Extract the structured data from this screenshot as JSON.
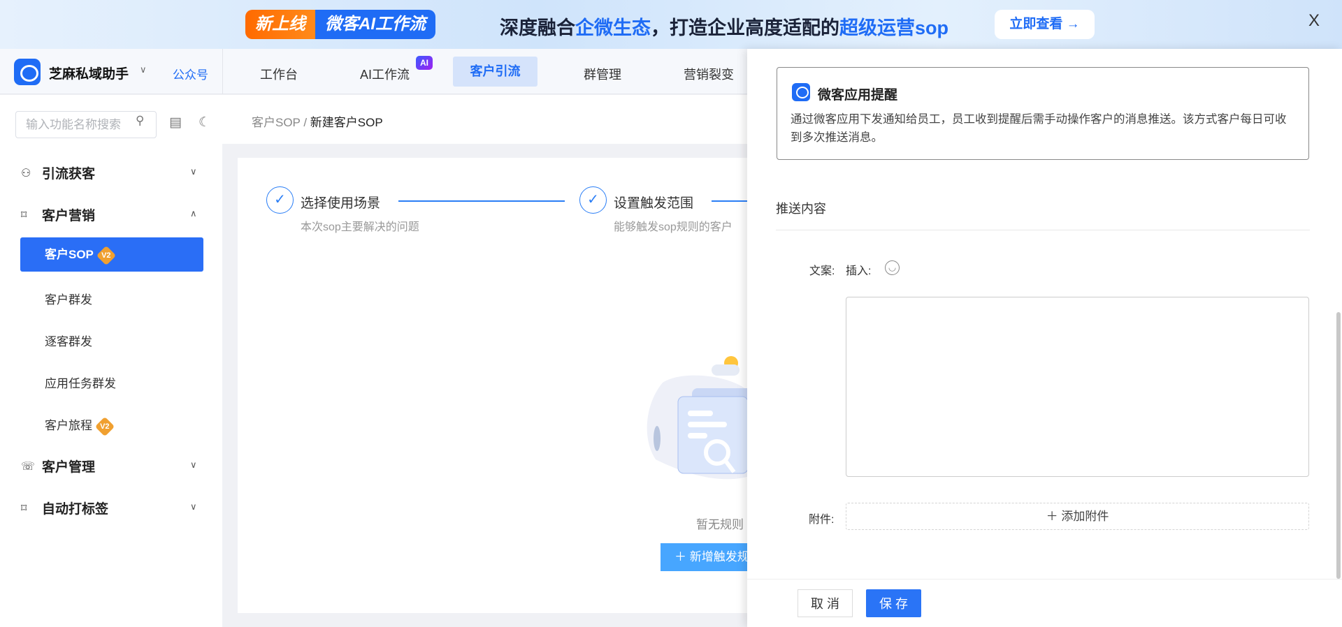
{
  "banner": {
    "tag_new": "新上线",
    "tag_product": "微客AI工作流",
    "slogan_a": "深度融合",
    "slogan_b": "企微生态",
    "slogan_c": "，打造企业高度适配的",
    "slogan_d": "超级运营sop",
    "cta": "立即查看 →",
    "close": "X"
  },
  "header": {
    "brand": "芝麻私域助手",
    "brand_chevron": "∨",
    "account": "公众号",
    "nav": [
      {
        "label": "工作台"
      },
      {
        "label": "AI工作流",
        "badge": "AI"
      },
      {
        "label": "客户引流",
        "active": true
      },
      {
        "label": "群管理"
      },
      {
        "label": "营销裂变"
      }
    ]
  },
  "sidebar": {
    "search_placeholder": "输入功能名称搜索",
    "groups": [
      {
        "label": "引流获客",
        "expanded": false
      },
      {
        "label": "客户营销",
        "expanded": true,
        "items": [
          {
            "label": "客户SOP",
            "badge": "V2",
            "active": true
          },
          {
            "label": "客户群发"
          },
          {
            "label": "逐客群发"
          },
          {
            "label": "应用任务群发"
          },
          {
            "label": "客户旅程",
            "badge": "V2"
          }
        ]
      },
      {
        "label": "客户管理",
        "expanded": false
      },
      {
        "label": "自动打标签",
        "expanded": false
      }
    ]
  },
  "breadcrumb": {
    "parent": "客户SOP",
    "sep": "/",
    "current": "新建客户SOP"
  },
  "steps": [
    {
      "title": "选择使用场景",
      "desc": "本次sop主要解决的问题"
    },
    {
      "title": "设置触发范围",
      "desc": "能够触发sop规则的客户"
    }
  ],
  "empty": {
    "text": "暂无规则",
    "button": "新增触发规则"
  },
  "drawer": {
    "notice_title": "微客应用提醒",
    "notice_desc": "通过微客应用下发通知给员工，员工收到提醒后需手动操作客户的消息推送。该方式客户每日可收到多次推送消息。",
    "section": "推送内容",
    "copy_label": "文案:",
    "insert_label": "插入:",
    "copy_value": "",
    "attach_label": "附件:",
    "attach_button": "＋ 添加附件",
    "cancel": "取 消",
    "save": "保 存"
  },
  "colors": {
    "primary": "#2a74f6",
    "banner_orange": "#ff6a00"
  }
}
